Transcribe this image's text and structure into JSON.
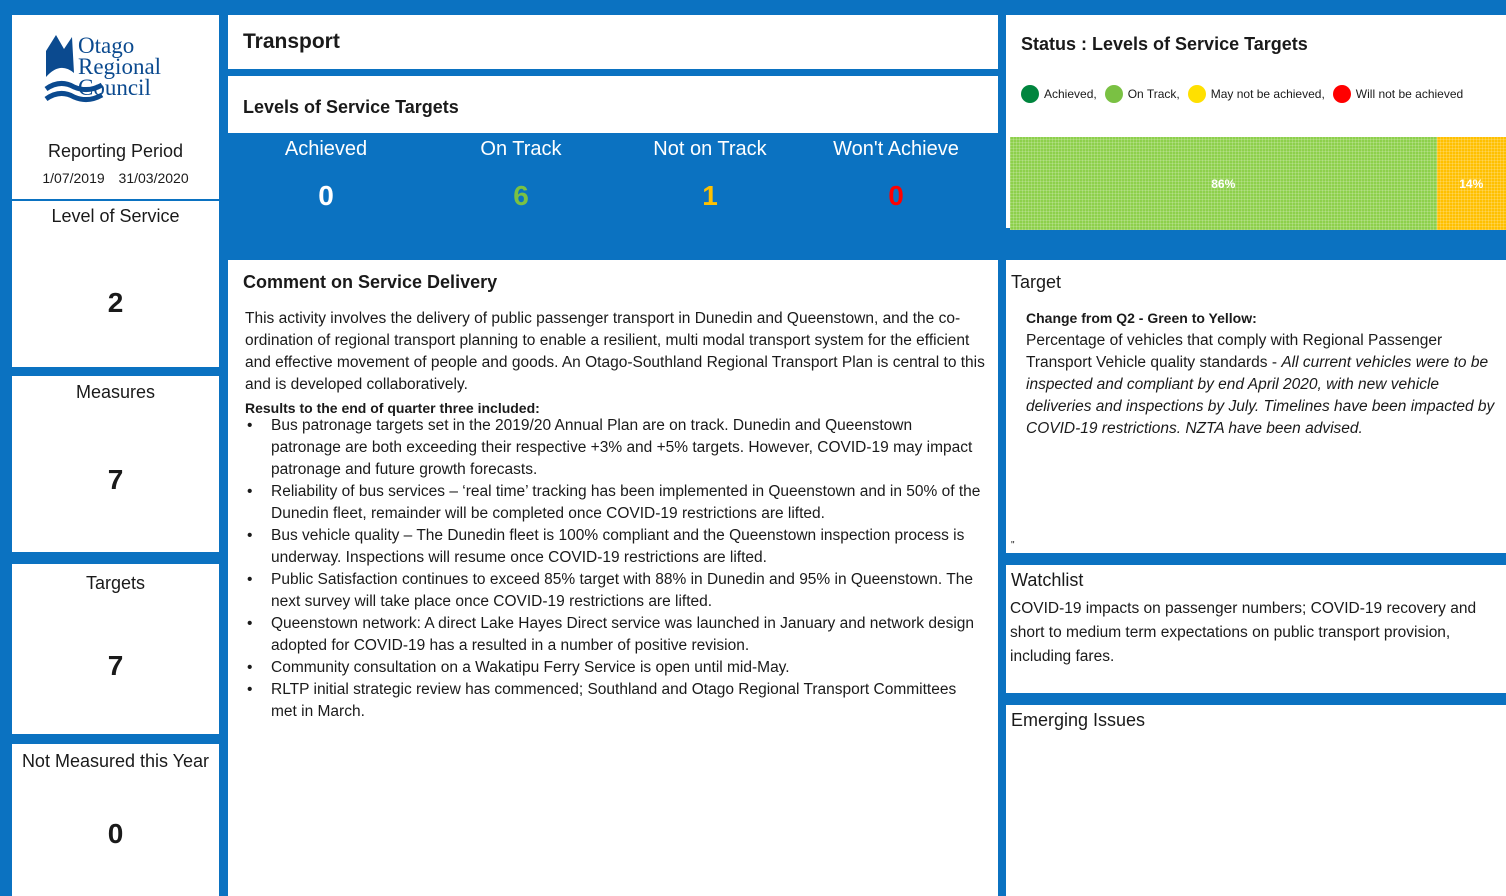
{
  "colors": {
    "frame": "#0b72c1",
    "achieved": "#00853e",
    "on_track": "#7ac143",
    "may_not": "#ffc90e",
    "will_not": "#ff0000",
    "bar_green": "#8dd04b",
    "bar_yellow": "#ffc000"
  },
  "logo": {
    "line1": "Otago",
    "line2": "Regional",
    "line3": "Council"
  },
  "reporting": {
    "label": "Reporting Period",
    "start": "1/07/2019",
    "end": "31/03/2020"
  },
  "stats": [
    {
      "label": "Level of Service",
      "value": "2"
    },
    {
      "label": "Measures",
      "value": "7"
    },
    {
      "label": "Targets",
      "value": "7"
    },
    {
      "label": "Not Measured this Year",
      "value": "0"
    }
  ],
  "header": {
    "title": "Transport",
    "los_title": "Levels of Service Targets"
  },
  "tiles": [
    {
      "label": "Achieved",
      "value": "0",
      "color": "#ffffff"
    },
    {
      "label": "On Track",
      "value": "6",
      "color": "#7ac143"
    },
    {
      "label": "Not on Track",
      "value": "1",
      "color": "#ffc000"
    },
    {
      "label": "Won't Achieve",
      "value": "0",
      "color": "#ff0000"
    }
  ],
  "comment": {
    "title": "Comment on Service Delivery",
    "paragraph": "This activity involves the delivery of public passenger transport in Dunedin and Queenstown, and the co-ordination of regional transport planning to enable a resilient, multi modal transport system for the efficient and effective movement of people and goods.  An Otago-Southland Regional Transport Plan is central to this and is developed collaboratively.",
    "results_heading": "Results to the end of quarter three included:",
    "bullets": [
      "Bus patronage targets set in the 2019/20 Annual Plan are on track. Dunedin and Queenstown patronage are both exceeding their respective +3% and +5% targets. However, COVID-19 may impact patronage and future growth forecasts.",
      "Reliability of bus services – ‘real time’ tracking has been implemented in Queenstown and in 50% of the Dunedin fleet, remainder will be completed once COVID-19 restrictions are lifted.",
      "Bus vehicle quality – The Dunedin fleet is 100% compliant and the Queenstown inspection process is underway.  Inspections will resume once COVID-19 restrictions are lifted.",
      "Public Satisfaction continues to exceed 85% target with 88% in Dunedin and 95% in Queenstown. The next survey will take place once COVID-19 restrictions are lifted.",
      "Queenstown network: A direct Lake Hayes Direct service was launched in January and network design adopted for COVID-19 has a resulted in a number of positive revision.",
      "Community consultation on a Wakatipu Ferry Service is open until mid-May.",
      "RLTP initial strategic review has commenced; Southland and Otago Regional Transport Committees met in March."
    ]
  },
  "status": {
    "title": "Status : Levels of Service Targets",
    "legend": [
      "Achieved,",
      "On Track,",
      "May not be achieved,",
      "Will not be achieved"
    ],
    "bar_segments": [
      {
        "label": "86%",
        "value": 0.86
      },
      {
        "label": "14%",
        "value": 0.14
      }
    ]
  },
  "target": {
    "heading": "Target",
    "subheading": "Change from Q2 - Green to Yellow:",
    "plain": "Percentage of vehicles that comply with Regional Passenger Transport Vehicle quality standards - ",
    "italic": "All current vehicles were to be inspected and compliant by end April 2020, with new vehicle deliveries and inspections by July. Timelines have been impacted by COVID-19 restrictions. NZTA have been advised.",
    "mark": "\""
  },
  "watchlist": {
    "heading": "Watchlist",
    "body": "COVID-19 impacts on passenger numbers; COVID-19 recovery and short to medium term expectations on public transport provision, including fares."
  },
  "emerging": {
    "heading": "Emerging Issues"
  }
}
